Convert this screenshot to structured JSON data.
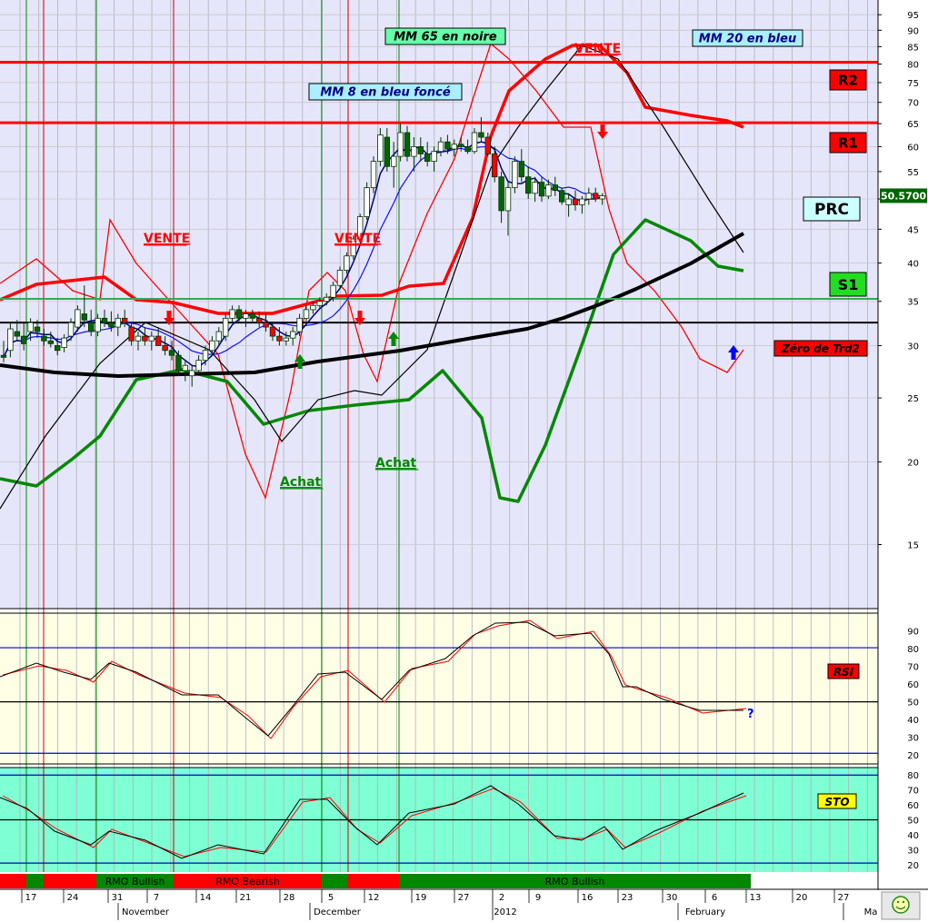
{
  "chart_data": {
    "type": "candlestick",
    "price_panel": {
      "y_scale": "log",
      "ylim": [
        12,
        100
      ],
      "y_ticks": [
        15,
        20,
        25,
        30,
        35,
        40,
        45,
        50,
        55,
        60,
        65,
        70,
        75,
        80,
        85,
        90,
        95
      ],
      "last_price": "50.5700",
      "horizontal_lines": [
        {
          "name": "R2",
          "value": 80.5,
          "color": "#ff0000"
        },
        {
          "name": "R1",
          "value": 65.2,
          "color": "#ff0000"
        },
        {
          "name": "S1",
          "value": 35.3,
          "color": "#33aa55"
        },
        {
          "name": "Zéro de Trd2",
          "value": 32.5,
          "color": "#000000"
        }
      ],
      "level_labels": [
        {
          "text": "R2",
          "bg": "#ff0000",
          "fg": "#000000"
        },
        {
          "text": "R1",
          "bg": "#ff0000",
          "fg": "#000000"
        },
        {
          "text": "PRC",
          "bg": "#ccffff",
          "fg": "#000000"
        },
        {
          "text": "S1",
          "bg": "#22dd22",
          "fg": "#000000"
        },
        {
          "text": "Zéro de Trd2",
          "bg": "#ff0000",
          "fg": "#000000"
        }
      ],
      "annotations": [
        {
          "text": "MM 65 en noire",
          "bg": "#66ffaa",
          "color": "#000000",
          "boxed": true
        },
        {
          "text": "MM 20 en bleu",
          "bg": "#aaeeff",
          "color": "#000080",
          "boxed": true
        },
        {
          "text": "MM 8 en bleu foncé",
          "bg": "#aaeeff",
          "color": "#000080",
          "boxed": true
        },
        {
          "text": "VENTE",
          "color": "#ff0000",
          "boxed": false
        },
        {
          "text": "VENTE",
          "color": "#ff0000",
          "boxed": false
        },
        {
          "text": "VENTE",
          "color": "#ff0000",
          "boxed": false
        },
        {
          "text": "Achat",
          "color": "#008800",
          "boxed": false
        },
        {
          "text": "Achat",
          "color": "#008800",
          "boxed": false
        }
      ],
      "series": [
        {
          "name": "MM 8",
          "color": "#000080",
          "values": []
        },
        {
          "name": "MM 20",
          "color": "#1010ff",
          "values": []
        },
        {
          "name": "MM 65",
          "color": "#000000",
          "values": []
        }
      ],
      "bollinger_upper_color": "#ff0000",
      "bollinger_lower_color": "#008800",
      "envelope_color": "#ff0000",
      "thick_trend_color": "#000000",
      "candles": [
        {
          "o": 29.0,
          "h": 30.5,
          "l": 28.3,
          "c": 28.8
        },
        {
          "o": 29.5,
          "h": 32.5,
          "l": 28.8,
          "c": 31.8
        },
        {
          "o": 31.5,
          "h": 32.8,
          "l": 30.5,
          "c": 31.0
        },
        {
          "o": 31.0,
          "h": 32.5,
          "l": 29.5,
          "c": 30.2
        },
        {
          "o": 31.5,
          "h": 33.0,
          "l": 30.5,
          "c": 32.5
        },
        {
          "o": 32.0,
          "h": 32.8,
          "l": 30.8,
          "c": 31.5
        },
        {
          "o": 31.0,
          "h": 31.8,
          "l": 30.0,
          "c": 30.5
        },
        {
          "o": 30.5,
          "h": 31.5,
          "l": 29.8,
          "c": 30.2
        },
        {
          "o": 30.0,
          "h": 30.8,
          "l": 29.0,
          "c": 29.5
        },
        {
          "o": 29.8,
          "h": 31.2,
          "l": 29.3,
          "c": 30.8
        },
        {
          "o": 31.0,
          "h": 33.0,
          "l": 30.5,
          "c": 32.5
        },
        {
          "o": 32.0,
          "h": 34.5,
          "l": 31.5,
          "c": 34.0
        },
        {
          "o": 33.5,
          "h": 37.0,
          "l": 32.0,
          "c": 32.8
        },
        {
          "o": 32.5,
          "h": 34.0,
          "l": 31.0,
          "c": 31.5
        },
        {
          "o": 31.5,
          "h": 33.5,
          "l": 31.0,
          "c": 33.0
        },
        {
          "o": 33.0,
          "h": 34.0,
          "l": 32.0,
          "c": 32.5
        },
        {
          "o": 32.5,
          "h": 33.8,
          "l": 31.5,
          "c": 32.0
        },
        {
          "o": 32.0,
          "h": 33.5,
          "l": 31.0,
          "c": 33.0
        },
        {
          "o": 33.0,
          "h": 34.0,
          "l": 32.0,
          "c": 32.5
        },
        {
          "o": 32.0,
          "h": 32.5,
          "l": 30.0,
          "c": 30.5
        },
        {
          "o": 30.5,
          "h": 31.5,
          "l": 29.5,
          "c": 31.0
        },
        {
          "o": 31.0,
          "h": 32.0,
          "l": 30.0,
          "c": 30.5
        },
        {
          "o": 30.5,
          "h": 31.5,
          "l": 29.5,
          "c": 31.0
        },
        {
          "o": 31.0,
          "h": 32.0,
          "l": 30.0,
          "c": 30.0
        },
        {
          "o": 30.0,
          "h": 31.0,
          "l": 29.0,
          "c": 29.5
        },
        {
          "o": 29.5,
          "h": 30.5,
          "l": 28.5,
          "c": 29.0
        },
        {
          "o": 29.0,
          "h": 29.5,
          "l": 27.0,
          "c": 27.5
        },
        {
          "o": 27.5,
          "h": 28.5,
          "l": 26.5,
          "c": 28.0
        },
        {
          "o": 27.0,
          "h": 28.0,
          "l": 26.0,
          "c": 27.5
        },
        {
          "o": 27.5,
          "h": 29.0,
          "l": 27.0,
          "c": 28.5
        },
        {
          "o": 28.5,
          "h": 30.0,
          "l": 28.0,
          "c": 29.5
        },
        {
          "o": 29.5,
          "h": 31.0,
          "l": 29.0,
          "c": 30.5
        },
        {
          "o": 30.5,
          "h": 32.0,
          "l": 30.0,
          "c": 31.5
        },
        {
          "o": 31.0,
          "h": 33.5,
          "l": 30.5,
          "c": 33.0
        },
        {
          "o": 33.0,
          "h": 34.5,
          "l": 32.5,
          "c": 34.0
        },
        {
          "o": 34.0,
          "h": 34.5,
          "l": 32.5,
          "c": 33.0
        },
        {
          "o": 33.0,
          "h": 34.0,
          "l": 32.0,
          "c": 33.5
        },
        {
          "o": 33.5,
          "h": 34.0,
          "l": 32.5,
          "c": 33.0
        },
        {
          "o": 33.0,
          "h": 33.8,
          "l": 32.0,
          "c": 32.5
        },
        {
          "o": 32.5,
          "h": 33.5,
          "l": 31.5,
          "c": 32.0
        },
        {
          "o": 32.0,
          "h": 32.5,
          "l": 30.5,
          "c": 31.0
        },
        {
          "o": 31.0,
          "h": 32.0,
          "l": 30.0,
          "c": 30.5
        },
        {
          "o": 30.5,
          "h": 31.5,
          "l": 30.0,
          "c": 30.8
        },
        {
          "o": 30.8,
          "h": 32.0,
          "l": 30.0,
          "c": 31.5
        },
        {
          "o": 31.5,
          "h": 33.5,
          "l": 31.0,
          "c": 33.0
        },
        {
          "o": 33.0,
          "h": 34.5,
          "l": 32.5,
          "c": 34.0
        },
        {
          "o": 34.0,
          "h": 35.0,
          "l": 33.5,
          "c": 34.5
        },
        {
          "o": 34.5,
          "h": 35.5,
          "l": 34.0,
          "c": 35.0
        },
        {
          "o": 35.0,
          "h": 36.0,
          "l": 34.5,
          "c": 35.5
        },
        {
          "o": 35.5,
          "h": 37.5,
          "l": 35.0,
          "c": 37.0
        },
        {
          "o": 37.0,
          "h": 39.5,
          "l": 36.5,
          "c": 39.0
        },
        {
          "o": 39.0,
          "h": 41.5,
          "l": 38.5,
          "c": 41.0
        },
        {
          "o": 41.0,
          "h": 44.0,
          "l": 40.5,
          "c": 43.5
        },
        {
          "o": 43.5,
          "h": 47.5,
          "l": 43.0,
          "c": 47.0
        },
        {
          "o": 47.0,
          "h": 53.0,
          "l": 46.5,
          "c": 52.0
        },
        {
          "o": 52.0,
          "h": 58.0,
          "l": 51.0,
          "c": 57.0
        },
        {
          "o": 57.0,
          "h": 64.0,
          "l": 56.0,
          "c": 62.5
        },
        {
          "o": 62.0,
          "h": 64.0,
          "l": 55.0,
          "c": 56.0
        },
        {
          "o": 56.0,
          "h": 61.0,
          "l": 52.0,
          "c": 58.0
        },
        {
          "o": 58.0,
          "h": 65.0,
          "l": 57.0,
          "c": 63.0
        },
        {
          "o": 63.0,
          "h": 64.5,
          "l": 57.0,
          "c": 58.0
        },
        {
          "o": 58.0,
          "h": 62.0,
          "l": 55.0,
          "c": 60.0
        },
        {
          "o": 60.0,
          "h": 62.0,
          "l": 57.0,
          "c": 58.5
        },
        {
          "o": 58.5,
          "h": 61.0,
          "l": 56.0,
          "c": 57.0
        },
        {
          "o": 57.0,
          "h": 60.0,
          "l": 55.0,
          "c": 59.0
        },
        {
          "o": 59.0,
          "h": 62.0,
          "l": 58.0,
          "c": 61.0
        },
        {
          "o": 61.0,
          "h": 62.5,
          "l": 58.5,
          "c": 59.5
        },
        {
          "o": 59.5,
          "h": 61.5,
          "l": 58.0,
          "c": 60.5
        },
        {
          "o": 60.5,
          "h": 62.0,
          "l": 59.0,
          "c": 60.0
        },
        {
          "o": 60.0,
          "h": 61.5,
          "l": 58.5,
          "c": 59.0
        },
        {
          "o": 59.0,
          "h": 64.0,
          "l": 58.5,
          "c": 63.0
        },
        {
          "o": 63.0,
          "h": 66.5,
          "l": 61.0,
          "c": 62.0
        },
        {
          "o": 62.0,
          "h": 63.0,
          "l": 58.0,
          "c": 58.5
        },
        {
          "o": 58.5,
          "h": 60.0,
          "l": 53.0,
          "c": 54.0
        },
        {
          "o": 54.0,
          "h": 55.0,
          "l": 46.0,
          "c": 48.0
        },
        {
          "o": 48.0,
          "h": 53.0,
          "l": 44.0,
          "c": 52.0
        },
        {
          "o": 52.0,
          "h": 58.0,
          "l": 51.0,
          "c": 57.0
        },
        {
          "o": 57.0,
          "h": 59.5,
          "l": 53.0,
          "c": 54.0
        },
        {
          "o": 54.0,
          "h": 56.0,
          "l": 50.0,
          "c": 51.0
        },
        {
          "o": 51.0,
          "h": 54.0,
          "l": 49.5,
          "c": 53.0
        },
        {
          "o": 53.0,
          "h": 54.0,
          "l": 49.5,
          "c": 50.5
        },
        {
          "o": 50.5,
          "h": 53.5,
          "l": 50.0,
          "c": 52.5
        },
        {
          "o": 52.5,
          "h": 54.0,
          "l": 50.5,
          "c": 51.5
        },
        {
          "o": 51.5,
          "h": 52.0,
          "l": 49.0,
          "c": 49.5
        },
        {
          "o": 49.0,
          "h": 51.0,
          "l": 47.0,
          "c": 50.0
        },
        {
          "o": 50.0,
          "h": 51.5,
          "l": 48.0,
          "c": 49.0
        },
        {
          "o": 49.0,
          "h": 50.5,
          "l": 47.5,
          "c": 50.0
        },
        {
          "o": 50.0,
          "h": 52.0,
          "l": 49.0,
          "c": 51.0
        },
        {
          "o": 51.0,
          "h": 52.0,
          "l": 49.5,
          "c": 50.0
        },
        {
          "o": 50.0,
          "h": 51.0,
          "l": 49.0,
          "c": 50.57
        }
      ]
    },
    "rsi_panel": {
      "label": "RSI",
      "label_bg": "#ff0000",
      "ylim": [
        15,
        100
      ],
      "y_ticks": [
        20,
        30,
        40,
        50,
        60,
        70,
        80,
        90
      ],
      "levels": [
        {
          "value": 80.5,
          "color": "#0000cc"
        },
        {
          "value": 50,
          "color": "#000000"
        },
        {
          "value": 21,
          "color": "#0000cc"
        }
      ],
      "question_mark": "?",
      "series": [
        {
          "color": "#000000",
          "values": []
        },
        {
          "color": "#ff0000",
          "values": []
        }
      ]
    },
    "sto_panel": {
      "label": "STO",
      "label_bg": "#ffff00",
      "ylim": [
        15,
        85
      ],
      "y_ticks": [
        20,
        30,
        40,
        50,
        60,
        70,
        80
      ],
      "levels": [
        {
          "value": 80,
          "color": "#0000cc"
        },
        {
          "value": 50,
          "color": "#000000"
        },
        {
          "value": 21,
          "color": "#0000cc"
        }
      ],
      "series": [
        {
          "color": "#000000",
          "values": []
        },
        {
          "color": "#ff0000",
          "values": []
        }
      ]
    },
    "rmo_bar": [
      {
        "label": "",
        "color": "#ff0000"
      },
      {
        "label": "",
        "color": "#008800"
      },
      {
        "label": "",
        "color": "#ff0000"
      },
      {
        "label": "RMO Bullish",
        "color": "#008800"
      },
      {
        "label": "RMO Bearish",
        "color": "#ff0000"
      },
      {
        "label": "",
        "color": "#008800"
      },
      {
        "label": "",
        "color": "#ff0000"
      },
      {
        "label": "RMO Bullish",
        "color": "#008800"
      }
    ],
    "x_ticks": [
      "17",
      "24",
      "31",
      "7",
      "14",
      "21",
      "28",
      "5",
      "12",
      "19",
      "27",
      "2",
      "9",
      "16",
      "23",
      "30",
      "6",
      "13",
      "20",
      "27"
    ],
    "x_months": [
      "November",
      "December",
      "2012",
      "February",
      "Ma"
    ],
    "status_icon": "smiley-icon"
  }
}
